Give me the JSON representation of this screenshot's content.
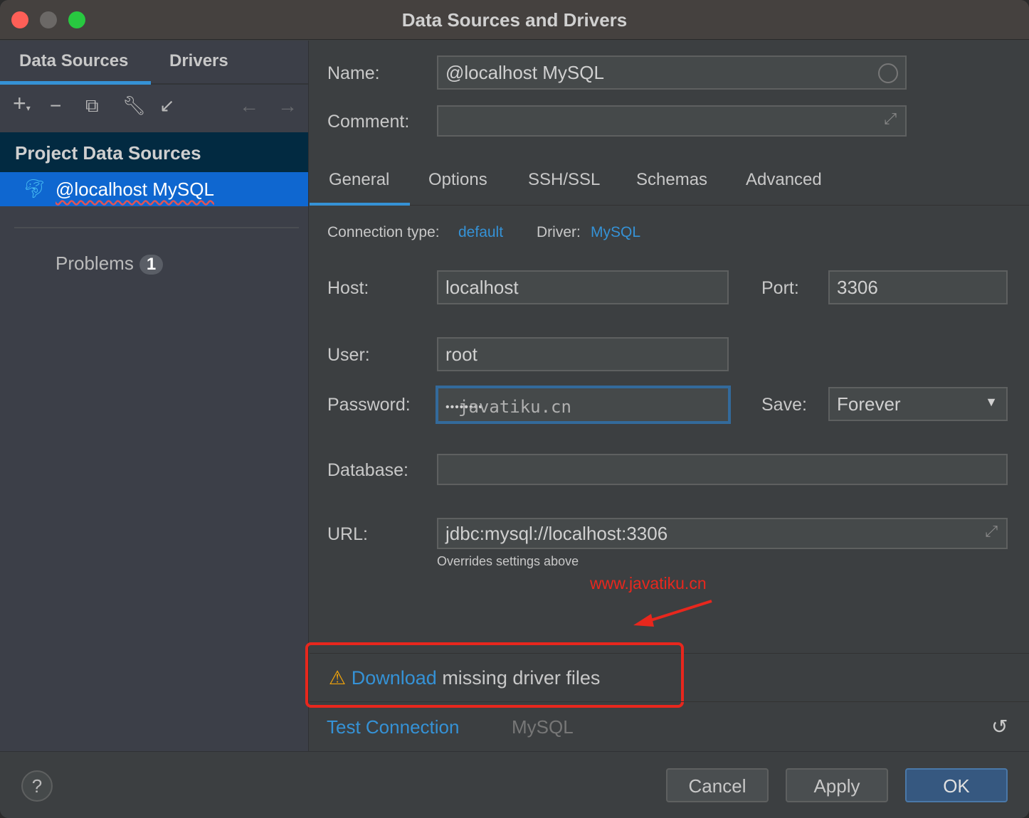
{
  "window": {
    "title": "Data Sources and Drivers"
  },
  "left": {
    "tabs": [
      "Data Sources",
      "Drivers"
    ],
    "group": "Project Data Sources",
    "selected": "@localhost MySQL",
    "problems_label": "Problems",
    "problems_count": "1"
  },
  "form": {
    "name_label": "Name:",
    "name_value": "@localhost MySQL",
    "comment_label": "Comment:",
    "comment_value": "",
    "tabs": [
      "General",
      "Options",
      "SSH/SSL",
      "Schemas",
      "Advanced"
    ],
    "conn_type_label": "Connection type:",
    "conn_type_value": "default",
    "driver_label": "Driver:",
    "driver_value": "MySQL",
    "host_label": "Host:",
    "host_value": "localhost",
    "port_label": "Port:",
    "port_value": "3306",
    "user_label": "User:",
    "user_value": "root",
    "password_label": "Password:",
    "password_value": "••••••••",
    "password_watermark": "javatiku.cn",
    "save_label": "Save:",
    "save_value": "Forever",
    "database_label": "Database:",
    "database_value": "",
    "url_label": "URL:",
    "url_value": "jdbc:mysql://localhost:3306",
    "url_hint": "Overrides settings above"
  },
  "annotation": {
    "watermark": "www.javatiku.cn",
    "color": "#e8271d"
  },
  "warning": {
    "link": "Download",
    "text": " missing driver files"
  },
  "footer": {
    "test_connection": "Test Connection",
    "driver_name": "MySQL"
  },
  "buttons": {
    "help": "?",
    "cancel": "Cancel",
    "apply": "Apply",
    "ok": "OK"
  },
  "colors": {
    "accent": "#3592d6",
    "selection": "#0f67d0",
    "ok": "#365880"
  }
}
